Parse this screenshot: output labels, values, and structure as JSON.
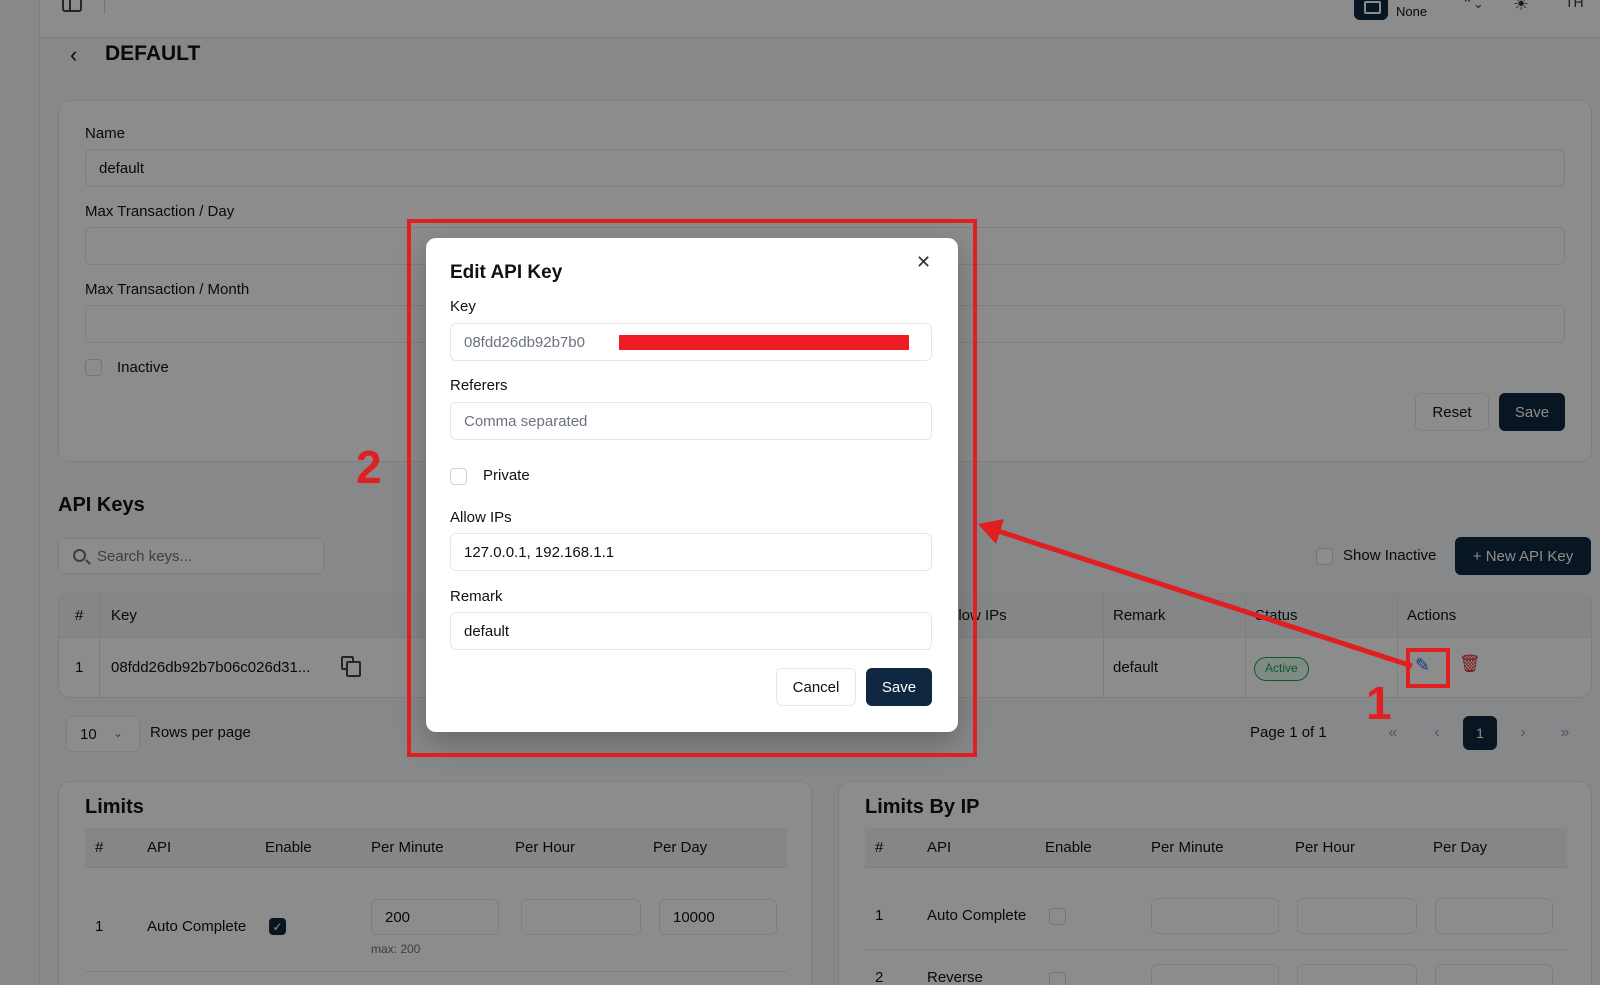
{
  "topbar": {
    "workspace_label": "None",
    "user_initials": "TH"
  },
  "page": {
    "title": "DEFAULT"
  },
  "settings_form": {
    "name_label": "Name",
    "name_value": "default",
    "max_day_label": "Max Transaction / Day",
    "max_month_label": "Max Transaction / Month",
    "inactive_label": "Inactive",
    "reset_label": "Reset",
    "save_label": "Save"
  },
  "api_keys": {
    "title": "API Keys",
    "search_placeholder": "Search keys...",
    "show_inactive_label": "Show Inactive",
    "new_button_label": "+ New API Key",
    "columns": [
      "#",
      "Key",
      "Allow IPs",
      "Remark",
      "Status",
      "Actions"
    ],
    "rows": [
      {
        "index": "1",
        "key": "08fdd26db92b7b06c026d31...",
        "remark": "default",
        "status": "Active"
      }
    ],
    "rows_per_page_value": "10",
    "rows_per_page_label": "Rows per page",
    "page_info": "Page 1 of 1",
    "current_page": "1"
  },
  "limits": {
    "title": "Limits",
    "columns": [
      "#",
      "API",
      "Enable",
      "Per Minute",
      "Per Hour",
      "Per Day"
    ],
    "rows": [
      {
        "index": "1",
        "api": "Auto Complete",
        "enabled": true,
        "per_minute": "200",
        "per_hour": "",
        "per_day": "10000",
        "hint": "max: 200"
      }
    ]
  },
  "limits_by_ip": {
    "title": "Limits By IP",
    "columns": [
      "#",
      "API",
      "Enable",
      "Per Minute",
      "Per Hour",
      "Per Day"
    ],
    "rows": [
      {
        "index": "1",
        "api": "Auto Complete",
        "enabled": false
      },
      {
        "index": "2",
        "api": "Reverse",
        "enabled": false
      }
    ]
  },
  "dialog": {
    "title": "Edit API Key",
    "key_label": "Key",
    "key_value": "08fdd26db92b7b0",
    "referers_label": "Referers",
    "referers_placeholder": "Comma separated",
    "private_label": "Private",
    "allow_ips_label": "Allow IPs",
    "allow_ips_value": "127.0.0.1, 192.168.1.1",
    "remark_label": "Remark",
    "remark_value": "default",
    "cancel_label": "Cancel",
    "save_label": "Save"
  },
  "annotations": {
    "step_1": "1",
    "step_2": "2",
    "color": "#e02020"
  },
  "colors": {
    "primary": "#0f2740",
    "active_badge": "#16a34a",
    "edit_icon": "#2563eb",
    "delete_icon": "#dc2626"
  }
}
